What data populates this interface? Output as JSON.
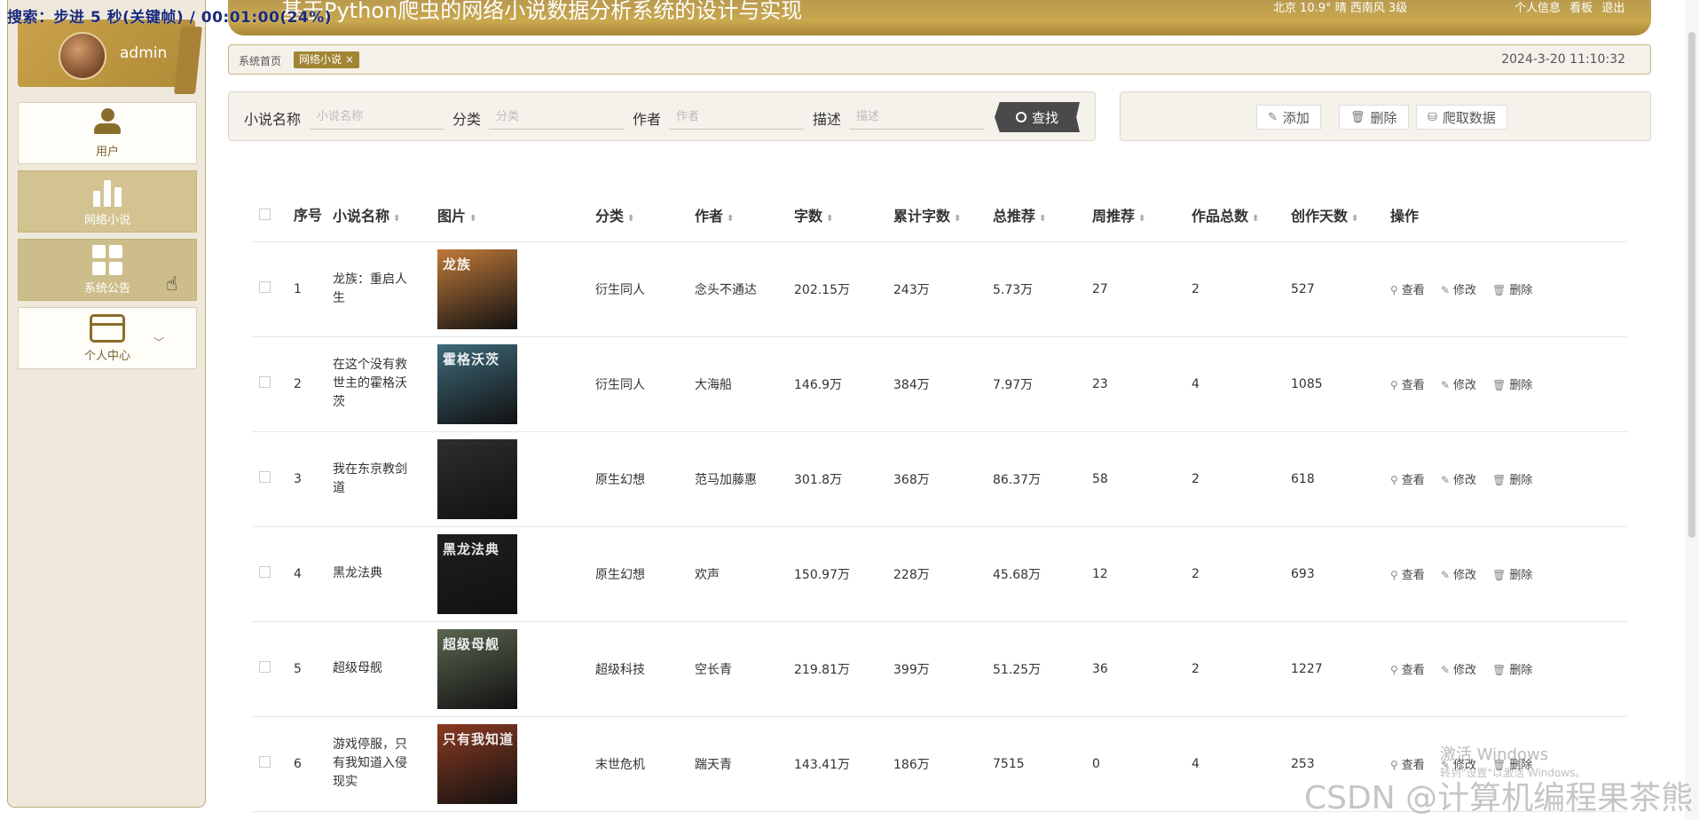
{
  "overlay_status": "搜索：步进 5 秒(关键帧) / 00:01:00(24%)",
  "header": {
    "title": "基于Python爬虫的网络小说数据分析系统的设计与实现",
    "weather": "北京 10.9° 晴 西南风 3级",
    "links": [
      "个人信息",
      "看板",
      "退出"
    ]
  },
  "user": {
    "name": "admin"
  },
  "sidebar": {
    "items": [
      {
        "label": "用户",
        "icon": "person-icon"
      },
      {
        "label": "网络小说",
        "icon": "bar-chart-icon"
      },
      {
        "label": "系统公告",
        "icon": "grid-icon"
      },
      {
        "label": "个人中心",
        "icon": "card-icon"
      }
    ]
  },
  "breadcrumb": {
    "home": "系统首页",
    "tag": "网络小说 ×",
    "time": "2024-3-20 11:10:32"
  },
  "search": {
    "fields": [
      {
        "label": "小说名称",
        "placeholder": "小说名称"
      },
      {
        "label": "分类",
        "placeholder": "分类"
      },
      {
        "label": "作者",
        "placeholder": "作者"
      },
      {
        "label": "描述",
        "placeholder": "描述"
      }
    ],
    "button": "查找"
  },
  "actions": {
    "add": "添加",
    "delete": "删除",
    "crawl": "爬取数据"
  },
  "table": {
    "headers": [
      "序号",
      "小说名称",
      "图片",
      "分类",
      "作者",
      "字数",
      "累计字数",
      "总推荐",
      "周推荐",
      "作品总数",
      "创作天数",
      "操作"
    ],
    "ops": {
      "view": "查看",
      "edit": "修改",
      "delete": "删除"
    },
    "rows": [
      {
        "idx": "1",
        "name": "龙族：重启人生",
        "cover_text": "龙族",
        "cover_color": "#c07a3a",
        "category": "衍生同人",
        "author": "念头不通达",
        "words": "202.15万",
        "total_words": "243万",
        "total_rec": "5.73万",
        "week_rec": "27",
        "works": "2",
        "days": "527"
      },
      {
        "idx": "2",
        "name": "在这个没有救世主的霍格沃茨",
        "cover_text": "霍格沃茨",
        "cover_color": "#3e6a7a",
        "category": "衍生同人",
        "author": "大海船",
        "words": "146.9万",
        "total_words": "384万",
        "total_rec": "7.97万",
        "week_rec": "23",
        "works": "4",
        "days": "1085"
      },
      {
        "idx": "3",
        "name": "我在东京教剑道",
        "cover_text": "",
        "cover_color": "#2e2e2e",
        "category": "原生幻想",
        "author": "范马加藤惠",
        "words": "301.8万",
        "total_words": "368万",
        "total_rec": "86.37万",
        "week_rec": "58",
        "works": "2",
        "days": "618"
      },
      {
        "idx": "4",
        "name": "黑龙法典",
        "cover_text": "黑龙法典",
        "cover_color": "#1f1f1f",
        "category": "原生幻想",
        "author": "欢声",
        "words": "150.97万",
        "total_words": "228万",
        "total_rec": "45.68万",
        "week_rec": "12",
        "works": "2",
        "days": "693"
      },
      {
        "idx": "5",
        "name": "超级母舰",
        "cover_text": "超级母舰",
        "cover_color": "#5a6650",
        "category": "超级科技",
        "author": "空长青",
        "words": "219.81万",
        "total_words": "399万",
        "total_rec": "51.25万",
        "week_rec": "36",
        "works": "2",
        "days": "1227"
      },
      {
        "idx": "6",
        "name": "游戏停服，只有我知道入侵现实",
        "cover_text": "只有我知道",
        "cover_color": "#8a3a22",
        "category": "末世危机",
        "author": "踹天青",
        "words": "143.41万",
        "total_words": "186万",
        "total_rec": "7515",
        "week_rec": "0",
        "works": "4",
        "days": "253"
      }
    ]
  },
  "watermark": "CSDN @计算机编程果茶熊",
  "windows_activate": "激活 Windows",
  "windows_activate_sub": "转到\"设置\"以激活 Windows。"
}
